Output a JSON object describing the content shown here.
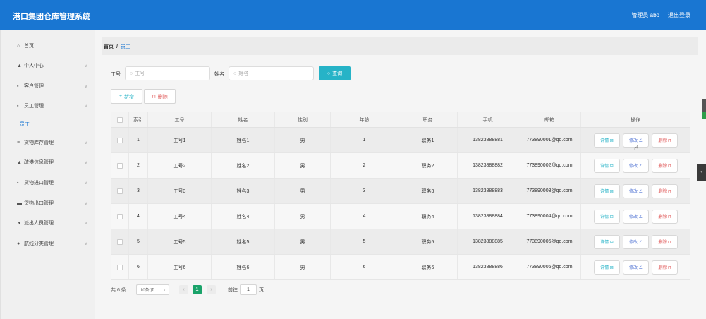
{
  "app": {
    "title": "港口集团仓库管理系统"
  },
  "header": {
    "user": "管理员 abo",
    "logout": "退出登录"
  },
  "sidebar": {
    "items": [
      {
        "label": "首页",
        "icon": "home-icon",
        "glyph": "⌂"
      },
      {
        "label": "个人中心",
        "icon": "person-icon",
        "glyph": "▲"
      },
      {
        "label": "客户管理",
        "icon": "grid-icon",
        "glyph": "▪"
      },
      {
        "label": "员工管理",
        "icon": "grid-icon",
        "glyph": "▪"
      },
      {
        "label": "货物库存管理",
        "icon": "list-icon",
        "glyph": "≡"
      },
      {
        "label": "疏港信息管理",
        "icon": "person-icon",
        "glyph": "▲"
      },
      {
        "label": "货物进口管理",
        "icon": "grid-icon",
        "glyph": "▪"
      },
      {
        "label": "货物出口管理",
        "icon": "box-icon",
        "glyph": "▬"
      },
      {
        "label": "派出人员管理",
        "icon": "cup-icon",
        "glyph": "▼"
      },
      {
        "label": "航线分类管理",
        "icon": "pin-icon",
        "glyph": "●"
      }
    ],
    "sub_active": "员工"
  },
  "breadcrumb": {
    "home": "首页",
    "sep": "/",
    "current": "员工"
  },
  "filters": {
    "id_label": "工号",
    "id_placeholder": "工号",
    "name_label": "姓名",
    "name_placeholder": "姓名",
    "search_button": "查询"
  },
  "actions": {
    "add": "新增",
    "delete": "删除"
  },
  "table": {
    "headers": [
      "索引",
      "工号",
      "姓名",
      "性别",
      "年龄",
      "职务",
      "手机",
      "邮箱",
      "操作"
    ],
    "rows": [
      [
        "1",
        "工号1",
        "姓名1",
        "男",
        "1",
        "职务1",
        "13823888881",
        "773890001@qq.com"
      ],
      [
        "2",
        "工号2",
        "姓名2",
        "男",
        "2",
        "职务2",
        "13823888882",
        "773890002@qq.com"
      ],
      [
        "3",
        "工号3",
        "姓名3",
        "男",
        "3",
        "职务3",
        "13823888883",
        "773890003@qq.com"
      ],
      [
        "4",
        "工号4",
        "姓名4",
        "男",
        "4",
        "职务4",
        "13823888884",
        "773890004@qq.com"
      ],
      [
        "5",
        "工号5",
        "姓名5",
        "男",
        "5",
        "职务5",
        "13823888885",
        "773890005@qq.com"
      ],
      [
        "6",
        "工号6",
        "姓名6",
        "男",
        "6",
        "职务6",
        "13823888886",
        "773890006@qq.com"
      ]
    ],
    "ops": {
      "detail": "详情 ⊟",
      "edit": "修改 ∠",
      "remove": "删除 ⊓"
    }
  },
  "pagination": {
    "total": "共 6 条",
    "page_size": "10条/页",
    "current": "1",
    "goto_prefix": "前往",
    "goto_value": "1",
    "goto_suffix": "页"
  },
  "colors": {
    "primary": "#1976d2",
    "search": "#26b3c7",
    "danger": "#e05a5a",
    "page_active": "#1aa36a"
  }
}
